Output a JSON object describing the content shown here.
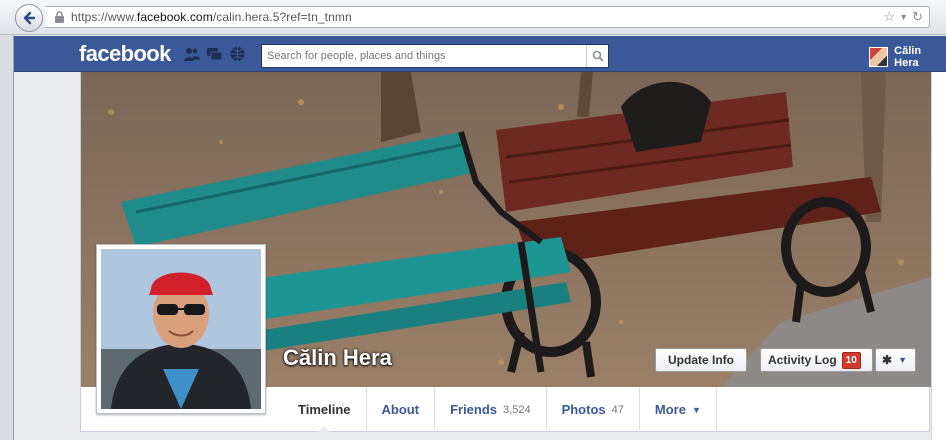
{
  "browser": {
    "url_prefix": "https://www.",
    "url_domain": "facebook.com",
    "url_suffix": "/calin.hera.5?ref=tn_tnmn",
    "icons": [
      "back-arrow-icon",
      "lock-icon",
      "star-icon",
      "dropdown-icon",
      "refresh-icon"
    ]
  },
  "header": {
    "logo": "facebook",
    "search_placeholder": "Search for people, places and things",
    "user_name": "Călin Hera",
    "colors": {
      "bar": "#3b5998",
      "bar_border": "#2d4373"
    }
  },
  "profile": {
    "name": "Călin Hera",
    "update_info_label": "Update Info",
    "activity_log_label": "Activity Log",
    "activity_count": "10"
  },
  "tabs": [
    {
      "label": "Timeline",
      "count": ""
    },
    {
      "label": "About",
      "count": ""
    },
    {
      "label": "Friends",
      "count": "3,524"
    },
    {
      "label": "Photos",
      "count": "47"
    },
    {
      "label": "More",
      "count": ""
    }
  ],
  "colors": {
    "count_badge": "#d23c30",
    "link": "#3b5998",
    "page_bg": "#e9eaed"
  }
}
